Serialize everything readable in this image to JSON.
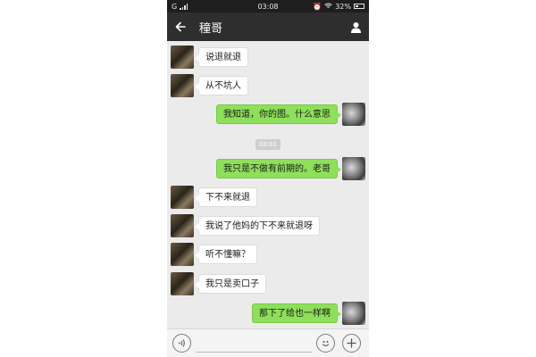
{
  "status_bar": {
    "carrier": "G",
    "network_label": "",
    "time": "03:08",
    "battery": "32%"
  },
  "header": {
    "title": "穜哥",
    "back_icon": "arrow-left-icon",
    "profile_icon": "person-icon"
  },
  "timestamp": "03:01",
  "messages": [
    {
      "side": "left",
      "text": "说退就退"
    },
    {
      "side": "left",
      "text": "从不坑人"
    },
    {
      "side": "right",
      "text": "我知道，你的图。什么意思"
    },
    {
      "side": "right",
      "text": "我只是不做有前期的。老哥"
    },
    {
      "side": "left",
      "text": "下不来就退"
    },
    {
      "side": "left",
      "text": "我说了他妈的下不来就退呀"
    },
    {
      "side": "left",
      "text": "听不懂嘛？"
    },
    {
      "side": "left",
      "text": "我只是卖口子"
    },
    {
      "side": "right",
      "text": "那下了给也一样啊"
    }
  ],
  "input_bar": {
    "placeholder": "",
    "voice_icon": "voice-icon",
    "emoji_icon": "emoji-icon",
    "plus_icon": "plus-icon"
  },
  "colors": {
    "header_bg": "#2e2e2e",
    "chat_bg": "#ebebeb",
    "sent_bubble": "#8ee05a",
    "received_bubble": "#ffffff"
  }
}
